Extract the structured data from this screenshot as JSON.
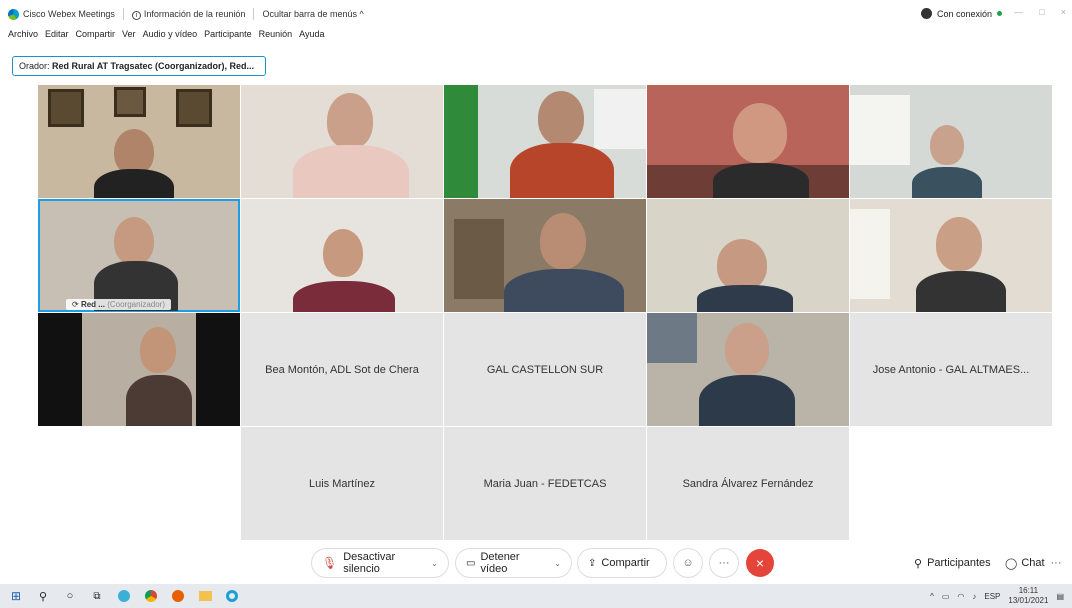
{
  "titlebar": {
    "app_name": "Cisco Webex Meetings",
    "info": "Información de la reunión",
    "hide_menu": "Ocultar barra de menús ^",
    "connection": "Con conexión"
  },
  "menu": [
    "Archivo",
    "Editar",
    "Compartir",
    "Ver",
    "Audio y vídeo",
    "Participante",
    "Reunión",
    "Ayuda"
  ],
  "speaker": {
    "prefix": "Orador:",
    "name": "Red Rural AT Tragsatec (Coorganizador), Red..."
  },
  "active_tag": {
    "name": "Red ...",
    "role": "(Coorganizador)"
  },
  "name_tiles": {
    "bea": "Bea Montón, ADL Sot de Chera",
    "gal": "GAL CASTELLON SUR",
    "jose": "Jose Antonio - GAL ALTMAES...",
    "luis": "Luis Martínez",
    "maria": "Maria Juan - FEDETCAS",
    "sandra": "Sandra Álvarez Fernández"
  },
  "controls": {
    "mute": "Desactivar silencio",
    "video": "Detener vídeo",
    "share": "Compartir",
    "participants": "Participantes",
    "chat": "Chat"
  },
  "taskbar": {
    "lang": "ESP",
    "time": "16:11",
    "date": "13/01/2021"
  },
  "colors": {
    "accent": "#1ca0e3",
    "leave": "#e5443a",
    "connected": "#1ca34a"
  }
}
